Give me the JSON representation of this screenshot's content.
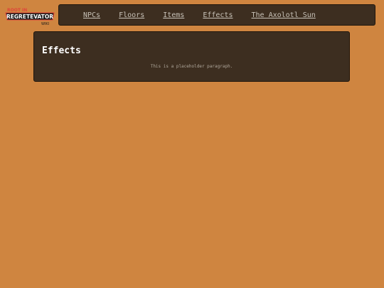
{
  "logo": {
    "top_text": "ROOT IN",
    "main_text": "REGRETEVATOR",
    "sub_text": "WIKI",
    "colors": {
      "accent": "#e0443a",
      "banner": "#1a1a1a",
      "text": "#ffffff"
    }
  },
  "nav": {
    "items": [
      {
        "label": "NPCs"
      },
      {
        "label": "Floors"
      },
      {
        "label": "Items"
      },
      {
        "label": "Effects"
      },
      {
        "label": "The Axolotl Sun"
      }
    ]
  },
  "main": {
    "title": "Effects",
    "paragraph": "This is a placeholder paragraph."
  },
  "colors": {
    "background": "#cf8540",
    "panel": "#3d2e20",
    "panel_border": "#1f160d",
    "nav_text": "#c7c1b7"
  }
}
